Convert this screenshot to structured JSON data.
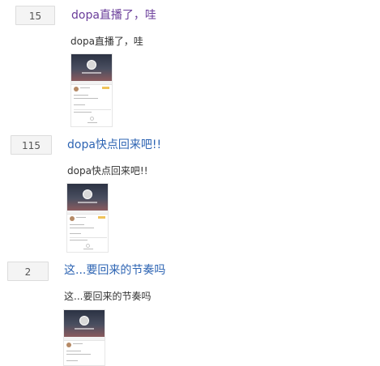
{
  "posts": [
    {
      "reply_count": "15",
      "title": "dopa直播了，哇",
      "excerpt": "dopa直播了，哇",
      "title_color": "#6a3d9a"
    },
    {
      "reply_count": "115",
      "title": "dopa快点回来吧!!",
      "excerpt": "dopa快点回来吧!!",
      "title_color": "#2d64b3"
    },
    {
      "reply_count": "2",
      "title": "这...要回来的节奏吗",
      "excerpt": "这...要回来的节奏吗",
      "title_color": "#2d64b3"
    }
  ]
}
